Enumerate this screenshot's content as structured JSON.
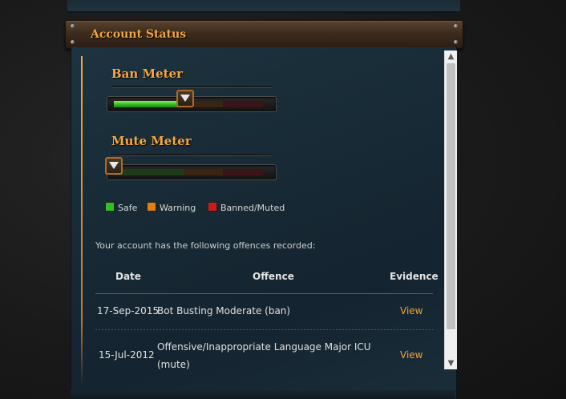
{
  "panel": {
    "title": "Account Status"
  },
  "ban_meter": {
    "title": "Ban Meter",
    "level": 0.46
  },
  "mute_meter": {
    "title": "Mute Meter",
    "level": 0.0
  },
  "legend": [
    {
      "label": "Safe",
      "color": "#2fc21f"
    },
    {
      "label": "Warning",
      "color": "#e07f14"
    },
    {
      "label": "Banned/Muted",
      "color": "#d01a1a"
    }
  ],
  "offences": {
    "intro": "Your account has the following offences recorded:",
    "headers": {
      "date": "Date",
      "offence": "Offence",
      "evidence": "Evidence"
    },
    "rows": [
      {
        "date": "17-Sep-2015",
        "offence_line1": "Bot Busting Moderate (ban)",
        "offence_line2": "",
        "evidence": "View"
      },
      {
        "date": "15-Jul-2012",
        "offence_line1": "Offensive/Inappropriate Language Major ICU",
        "offence_line2": "(mute)",
        "evidence": "View"
      }
    ]
  },
  "scrollbar": {
    "up_icon": "▲",
    "down_icon": "▼"
  }
}
